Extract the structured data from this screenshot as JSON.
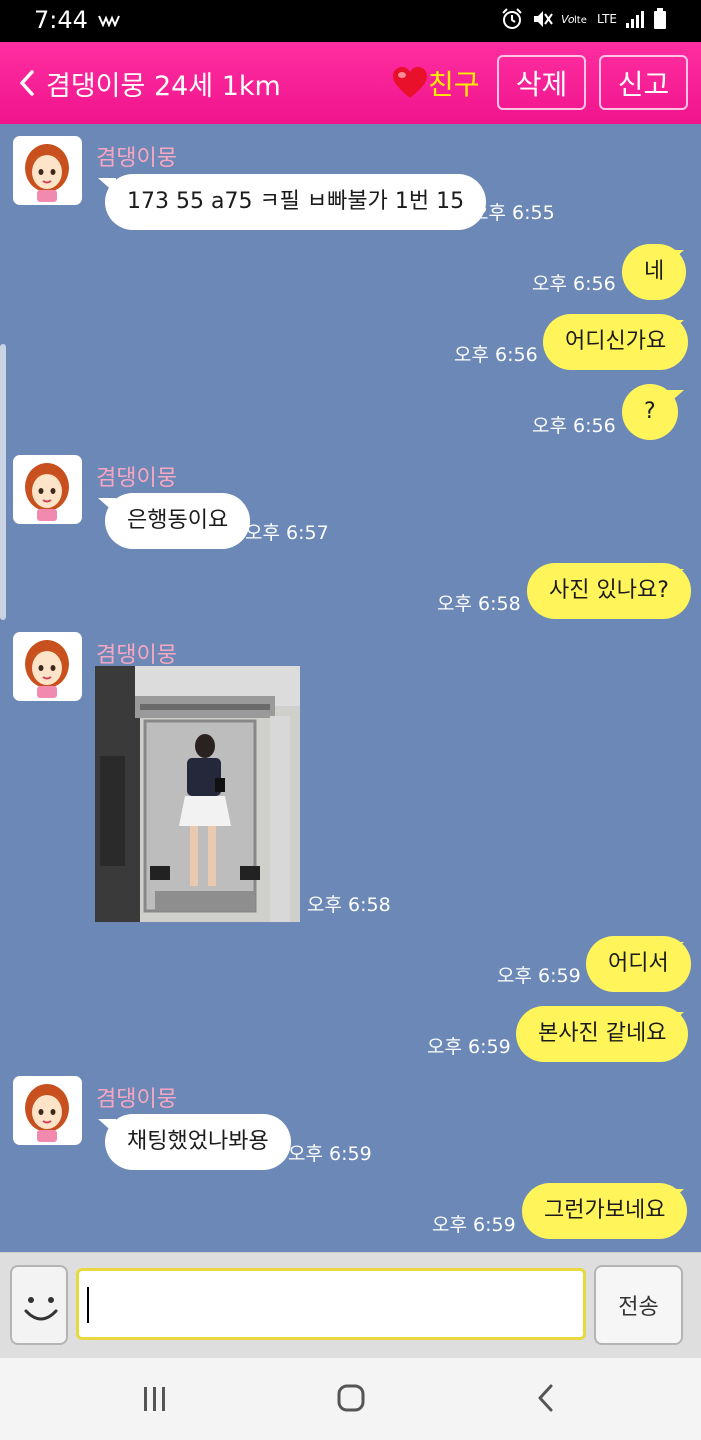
{
  "status_bar": {
    "time": "7:44",
    "network": "LTE"
  },
  "header": {
    "title": "겸댕이뭉 24세 1km",
    "friend_label": "친구",
    "delete_label": "삭제",
    "report_label": "신고"
  },
  "chat": {
    "sender_name": "겸댕이뭉",
    "messages": [
      {
        "from": "them",
        "text": "173 55 a75 ㅋ필 ㅂ빠불가 1번 15",
        "time": "오후 6:55"
      },
      {
        "from": "me",
        "text": "네",
        "time": "오후 6:56"
      },
      {
        "from": "me",
        "text": "어디신가요",
        "time": "오후 6:56"
      },
      {
        "from": "me",
        "text": "?",
        "time": "오후 6:56"
      },
      {
        "from": "them",
        "text": "은행동이요",
        "time": "오후 6:57"
      },
      {
        "from": "me",
        "text": "사진 있나요?",
        "time": "오후 6:58"
      },
      {
        "from": "them",
        "type": "photo",
        "time": "오후 6:58"
      },
      {
        "from": "me",
        "text": "어디서",
        "time": "오후 6:59"
      },
      {
        "from": "me",
        "text": "본사진 같네요",
        "time": "오후 6:59"
      },
      {
        "from": "them",
        "text": "채팅했었나봐용",
        "time": "오후 6:59"
      },
      {
        "from": "me",
        "text": "그런가보네요",
        "time": "오후 6:59"
      }
    ]
  },
  "input": {
    "value": "",
    "send_label": "전송"
  },
  "colors": {
    "header_pink": "#f0148c",
    "chat_bg": "#6c88b6",
    "my_bubble": "#fff55a",
    "their_bubble": "#ffffff",
    "friend_label": "#ffee00",
    "sender_name": "#f7a7c2"
  }
}
